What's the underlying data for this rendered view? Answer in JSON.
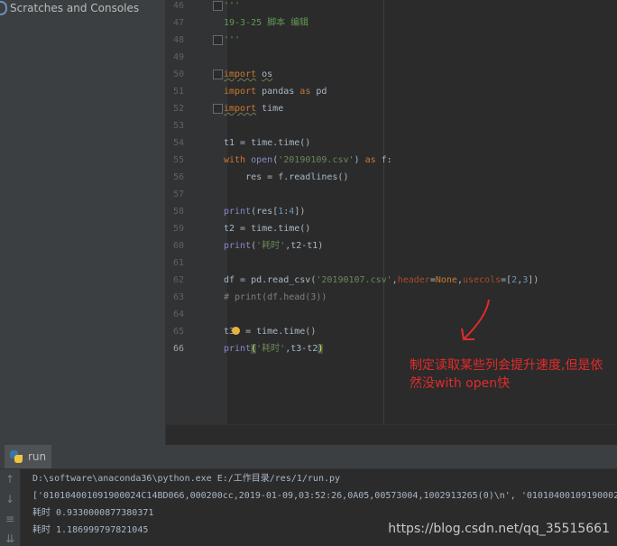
{
  "project_panel": {
    "scratches_label": "Scratches and Consoles"
  },
  "editor": {
    "lines": [
      {
        "n": "46",
        "code": "'''"
      },
      {
        "n": "47",
        "code": "19-3-25 脚本 编辑"
      },
      {
        "n": "48",
        "code": "'''"
      },
      {
        "n": "49",
        "code": ""
      },
      {
        "n": "50",
        "code": "import os"
      },
      {
        "n": "51",
        "code": "import pandas as pd"
      },
      {
        "n": "52",
        "code": "import time"
      },
      {
        "n": "53",
        "code": ""
      },
      {
        "n": "54",
        "code": "t1 = time.time()"
      },
      {
        "n": "55",
        "code": "with open('20190109.csv') as f:"
      },
      {
        "n": "56",
        "code": "    res = f.readlines()"
      },
      {
        "n": "57",
        "code": ""
      },
      {
        "n": "58",
        "code": "print(res[1:4])"
      },
      {
        "n": "59",
        "code": "t2 = time.time()"
      },
      {
        "n": "60",
        "code": "print('耗时',t2-t1)"
      },
      {
        "n": "61",
        "code": ""
      },
      {
        "n": "62",
        "code": "df = pd.read_csv('20190107.csv',header=None,usecols=[2,3])"
      },
      {
        "n": "63",
        "code": "# print(df.head(3))"
      },
      {
        "n": "64",
        "code": ""
      },
      {
        "n": "65",
        "code": "t3 = time.time()"
      },
      {
        "n": "66",
        "code": "print('耗时',t3-t2)"
      }
    ]
  },
  "annotation": {
    "text": "制定读取某些列会提升速度,但是依然没with open快"
  },
  "run_panel": {
    "tab_label": "run",
    "output": [
      "D:\\software\\anaconda36\\python.exe E:/工作目录/res/1/run.py",
      "['010104001091900024C14BD066,000200cc,2019-01-09,03:52:26,0A05,00573004,1002913265(0)\\n', '01010400109190002",
      "耗时 0.9330000877380371",
      "耗时 1.186999797821045"
    ]
  },
  "watermark": "https://blog.csdn.net/qq_35515661",
  "colors": {
    "keyword": "#cc7832",
    "string": "#6a8759",
    "number": "#6897bb",
    "comment": "#808080",
    "annotation": "#e22b2b"
  }
}
